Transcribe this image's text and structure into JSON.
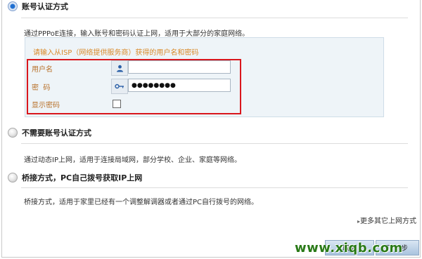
{
  "options": [
    {
      "title": "账号认证方式",
      "desc": "通过PPPoE连接，输入账号和密码认证上网，适用于大部分的家庭网络。",
      "selected": true
    },
    {
      "title": "不需要账号认证方式",
      "desc": "通过动态IP上网，适用于连接局域网，部分学校、企业、家庭等网络。",
      "selected": false
    },
    {
      "title": "桥接方式，PC自己拨号获取IP上网",
      "desc": "桥接方式，适用于家里已经有一个调整解调器或者通过PC自行拨号的网络。",
      "selected": false
    }
  ],
  "isp_box": {
    "hint": "请输入从ISP（网络提供服务商）获得的用户名和密码",
    "username_label": "用户名",
    "username_value": "",
    "password_label": "密  码",
    "password_value": "●●●●●●●●",
    "show_password_label": "显示密码",
    "show_password_checked": false,
    "user_icon": "user-icon",
    "key_icon": "key-icon"
  },
  "more_link": "更多其它上网方式",
  "buttons": {
    "cancel": "取消",
    "next": "下一步"
  },
  "watermark": "www.xiqb.com",
  "colors": {
    "highlight": "#d9161c",
    "hint": "#d98a2a",
    "watermark": "#2a7a18"
  }
}
